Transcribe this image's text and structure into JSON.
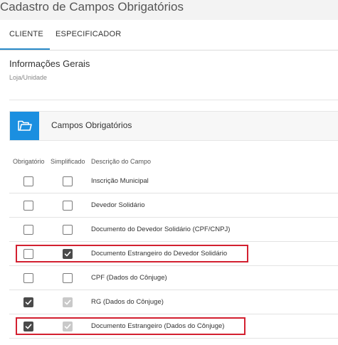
{
  "page": {
    "title": "Cadastro de Campos Obrigatórios"
  },
  "tabs": [
    {
      "label": "CLIENTE",
      "active": true
    },
    {
      "label": "ESPECIFICADOR",
      "active": false
    }
  ],
  "general": {
    "title": "Informações Gerais",
    "field_label": "Loja/Unidade"
  },
  "panel": {
    "title": "Campos Obrigatórios",
    "icon": "folder-icon"
  },
  "columns": {
    "obrigatorio": "Obrigatório",
    "simplificado": "Simplificado",
    "descricao": "Descrição do Campo"
  },
  "rows": [
    {
      "obrigatorio": false,
      "simplificado": false,
      "simplificado_disabled": false,
      "descricao": "Inscrição Municipal",
      "highlighted": false
    },
    {
      "obrigatorio": false,
      "simplificado": false,
      "simplificado_disabled": false,
      "descricao": "Devedor Solidário",
      "highlighted": false
    },
    {
      "obrigatorio": false,
      "simplificado": false,
      "simplificado_disabled": false,
      "descricao": "Documento do Devedor Solidário (CPF/CNPJ)",
      "highlighted": false
    },
    {
      "obrigatorio": false,
      "simplificado": true,
      "simplificado_disabled": false,
      "descricao": "Documento Estrangeiro do Devedor Solidário",
      "highlighted": true
    },
    {
      "obrigatorio": false,
      "simplificado": false,
      "simplificado_disabled": false,
      "descricao": "CPF (Dados do Cônjuge)",
      "highlighted": false
    },
    {
      "obrigatorio": true,
      "simplificado": true,
      "simplificado_disabled": true,
      "descricao": "RG (Dados do Cônjuge)",
      "highlighted": false
    },
    {
      "obrigatorio": true,
      "simplificado": true,
      "simplificado_disabled": true,
      "descricao": "Documento Estrangeiro (Dados do Cônjuge)",
      "highlighted": true
    }
  ],
  "colors": {
    "accent": "#1b8fe0",
    "tab_underline": "#2a8bc9",
    "highlight": "#d32030",
    "check": "#4a4a4a",
    "check_disabled": "#c9c9c9"
  }
}
